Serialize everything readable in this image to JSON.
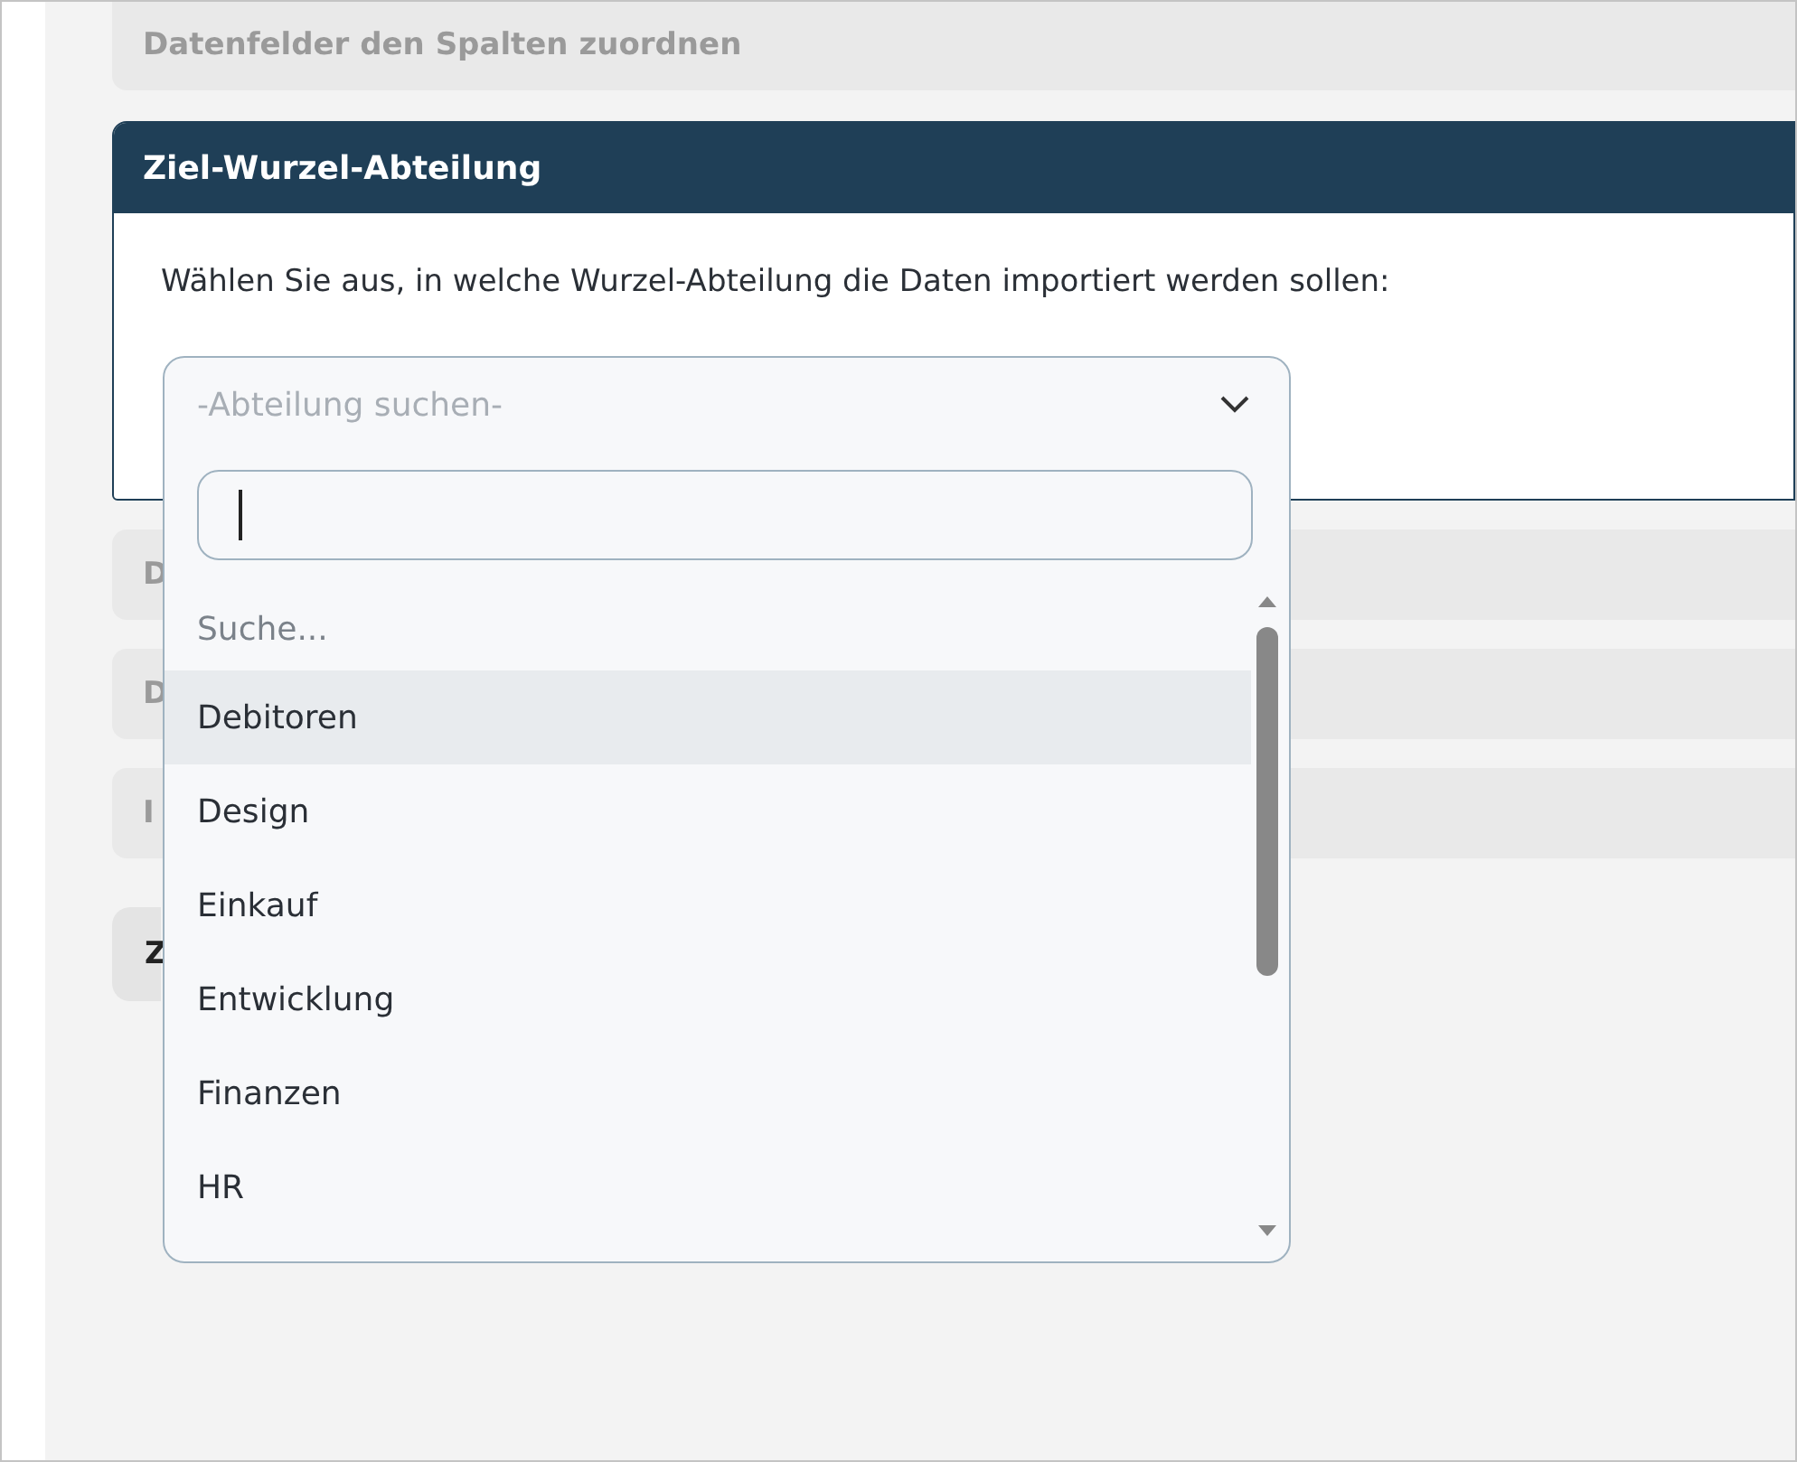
{
  "sections_above": [
    {
      "title": "Datenfelder den Spalten zuordnen"
    }
  ],
  "card": {
    "title": "Ziel-Wurzel-Abteilung",
    "text": "Wählen Sie aus, in welche Wurzel-Abteilung die Daten importiert werden sollen:"
  },
  "sections_below": [
    {
      "title": "D"
    },
    {
      "title": "D"
    },
    {
      "title": "I"
    }
  ],
  "button": {
    "label": "Z"
  },
  "dropdown": {
    "placeholder": "-Abteilung suchen-",
    "expanded": true,
    "options": [
      {
        "kind": "hint",
        "label": "Suche...",
        "selected": false
      },
      {
        "kind": "option",
        "label": "Debitoren",
        "selected": true
      },
      {
        "kind": "option",
        "label": "Design",
        "selected": false
      },
      {
        "kind": "option",
        "label": "Einkauf",
        "selected": false
      },
      {
        "kind": "option",
        "label": "Entwicklung",
        "selected": false
      },
      {
        "kind": "option",
        "label": "Finanzen",
        "selected": false
      },
      {
        "kind": "option",
        "label": "HR",
        "selected": false
      }
    ]
  }
}
